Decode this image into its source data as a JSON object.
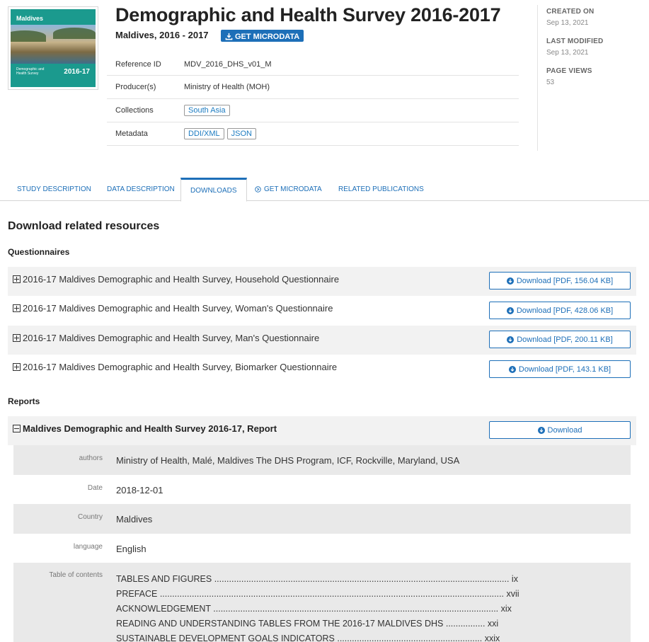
{
  "study": {
    "title": "Demographic and Health Survey 2016-2017",
    "subtitle": "Maldives, 2016 - 2017",
    "badge_label": "GET MICRODATA",
    "cover": {
      "country": "Maldives",
      "caption": "Demographic and Health Survey",
      "year": "2016-17"
    }
  },
  "meta": {
    "reference_id": {
      "label": "Reference ID",
      "value": "MDV_2016_DHS_v01_M"
    },
    "producer": {
      "label": "Producer(s)",
      "value": "Ministry of Health (MOH)"
    },
    "collections": {
      "label": "Collections",
      "tags": [
        "South Asia"
      ]
    },
    "metadata": {
      "label": "Metadata",
      "tags": [
        "DDI/XML",
        "JSON"
      ]
    }
  },
  "sidebar": {
    "created_label": "CREATED ON",
    "created_value": "Sep 13, 2021",
    "modified_label": "LAST MODIFIED",
    "modified_value": "Sep 13, 2021",
    "views_label": "PAGE VIEWS",
    "views_value": "53"
  },
  "tabs": [
    {
      "label": "STUDY DESCRIPTION"
    },
    {
      "label": "DATA DESCRIPTION"
    },
    {
      "label": "DOWNLOADS",
      "active": true
    },
    {
      "label": "GET MICRODATA"
    },
    {
      "label": "RELATED PUBLICATIONS"
    }
  ],
  "content": {
    "section_title": "Download related resources",
    "questionnaires_label": "Questionnaires",
    "questionnaires": [
      {
        "title": "2016-17 Maldives Demographic and Health Survey, Household Questionnaire",
        "button": "Download [PDF, 156.04 KB]"
      },
      {
        "title": "2016-17 Maldives Demographic and Health Survey, Woman's Questionnaire",
        "button": "Download [PDF, 428.06 KB]"
      },
      {
        "title": "2016-17 Maldives Demographic and Health Survey, Man's Questionnaire",
        "button": "Download [PDF, 200.11 KB]"
      },
      {
        "title": "2016-17 Maldives Demographic and Health Survey, Biomarker Questionnaire",
        "button": "Download [PDF, 143.1 KB]"
      }
    ],
    "reports_label": "Reports",
    "report": {
      "title": "Maldives Demographic and Health Survey 2016-17, Report",
      "button": "Download",
      "fields": [
        {
          "label": "authors",
          "value": "Ministry of Health, Malé, Maldives The DHS Program, ICF, Rockville, Maryland, USA"
        },
        {
          "label": "Date",
          "value": "2018-12-01"
        },
        {
          "label": "Country",
          "value": "Maldives"
        },
        {
          "label": "language",
          "value": "English"
        }
      ],
      "toc_label": "Table of contents",
      "toc": [
        "TABLES AND FIGURES ........................................................................................................................ ix",
        "PREFACE ............................................................................................................................................ xvii",
        "ACKNOWLEDGEMENT .................................................................................................................... xix",
        "READING AND UNDERSTANDING TABLES FROM THE 2016-17 MALDIVES DHS ................ xxi",
        "SUSTAINABLE DEVELOPMENT GOALS INDICATORS ........................................................... xxix"
      ]
    }
  },
  "colors": {
    "accent": "#1d6fb8",
    "row_shade": "#f2f2f2",
    "detail_shade": "#e9e9e9",
    "cover": "#1b9a8e"
  }
}
